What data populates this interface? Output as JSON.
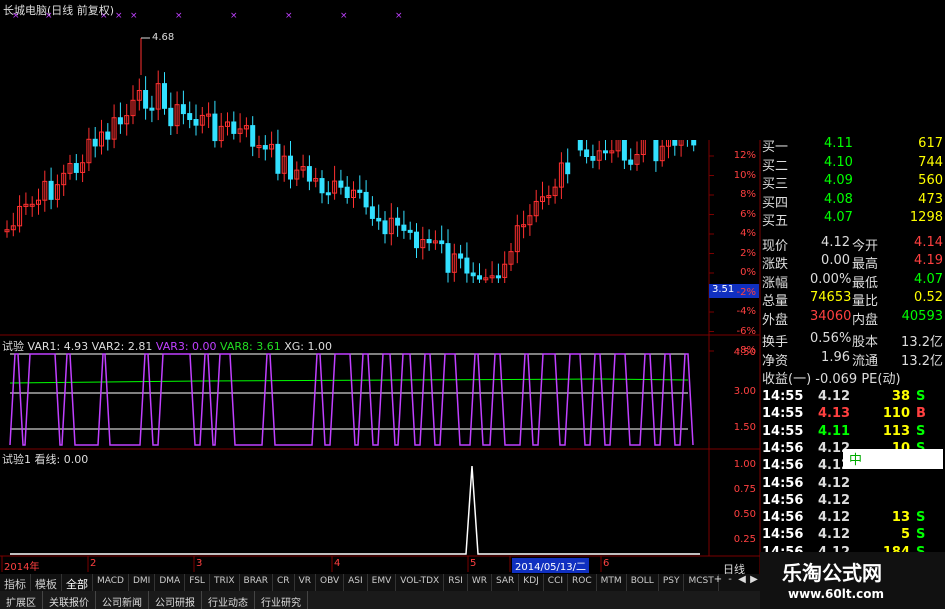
{
  "window_title": "长城电脑(日线 前复权)",
  "price_high_label": "4.68",
  "current_price_tag": "3.51",
  "colors": {
    "up": "#ff3030",
    "down": "#33e0ff",
    "magenta": "#c040ff",
    "green": "#00ff00",
    "yellow": "#ffff00",
    "grid": "#7a0000",
    "white": "#ffffff"
  },
  "pct_axis": [
    "12%",
    "10%",
    "8%",
    "6%",
    "4%",
    "2%",
    "0%",
    "-2%",
    "-4%",
    "-6%",
    "-8%"
  ],
  "indicator1": {
    "name": "试验",
    "vars": [
      {
        "label": "VAR1: 4.93",
        "color": "#dddddd"
      },
      {
        "label": "VAR2: 2.81",
        "color": "#dddddd"
      },
      {
        "label": "VAR3: 0.00",
        "color": "#c040ff"
      },
      {
        "label": "VAR8: 3.61",
        "color": "#22dd22"
      },
      {
        "label": "XG: 1.00",
        "color": "#dddddd"
      }
    ],
    "axis": [
      "4.50",
      "3.00",
      "1.50"
    ]
  },
  "indicator2": {
    "name": "试验1",
    "vars": [
      {
        "label": "看线: 0.00",
        "color": "#dddddd"
      }
    ],
    "axis": [
      "1.00",
      "0.75",
      "0.50",
      "0.25"
    ]
  },
  "date_axis": [
    {
      "label": "2014年",
      "highlight": false
    },
    {
      "label": "2",
      "highlight": false
    },
    {
      "label": "3",
      "highlight": false
    },
    {
      "label": "4",
      "highlight": false
    },
    {
      "label": "5",
      "highlight": false
    },
    {
      "label": "2014/05/13/二",
      "highlight": true
    },
    {
      "label": "6",
      "highlight": false
    }
  ],
  "period": "日线",
  "quotes": [
    {
      "label": "买一",
      "price": "4.11",
      "vol": "617",
      "pcolor": "#00ff00"
    },
    {
      "label": "买二",
      "price": "4.10",
      "vol": "744",
      "pcolor": "#00ff00"
    },
    {
      "label": "买三",
      "price": "4.09",
      "vol": "560",
      "pcolor": "#00ff00"
    },
    {
      "label": "买四",
      "price": "4.08",
      "vol": "473",
      "pcolor": "#00ff00"
    },
    {
      "label": "买五",
      "price": "4.07",
      "vol": "1298",
      "pcolor": "#00ff00"
    }
  ],
  "stats": [
    {
      "l1": "现价",
      "v1": "4.12",
      "c1": "#dddddd",
      "l2": "今开",
      "v2": "4.14",
      "c2": "#ff4040"
    },
    {
      "l1": "涨跌",
      "v1": "0.00",
      "c1": "#dddddd",
      "l2": "最高",
      "v2": "4.19",
      "c2": "#ff4040"
    },
    {
      "l1": "涨幅",
      "v1": "0.00%",
      "c1": "#dddddd",
      "l2": "最低",
      "v2": "4.07",
      "c2": "#00ff00"
    },
    {
      "l1": "总量",
      "v1": "74653",
      "c1": "#ffff00",
      "l2": "量比",
      "v2": "0.52",
      "c2": "#ffff00"
    },
    {
      "l1": "外盘",
      "v1": "34060",
      "c1": "#ff4040",
      "l2": "内盘",
      "v2": "40593",
      "c2": "#00ff00"
    },
    {
      "l1": "换手",
      "v1": "0.56%",
      "c1": "#dddddd",
      "l2": "股本",
      "v2": "13.2亿",
      "c2": "#dddddd"
    },
    {
      "l1": "净资",
      "v1": "1.96",
      "c1": "#dddddd",
      "l2": "流通",
      "v2": "13.2亿",
      "c2": "#dddddd"
    }
  ],
  "earnings": "收益(一) -0.069 PE(动)",
  "ticks": [
    {
      "time": "14:55",
      "price": "4.12",
      "vol": "38",
      "bs": "S",
      "pc": "#dddddd",
      "bc": "#00ff00"
    },
    {
      "time": "14:55",
      "price": "4.13",
      "vol": "110",
      "bs": "B",
      "pc": "#ff4040",
      "bc": "#ff4040"
    },
    {
      "time": "14:55",
      "price": "4.11",
      "vol": "113",
      "bs": "S",
      "pc": "#00ff00",
      "bc": "#00ff00"
    },
    {
      "time": "14:56",
      "price": "4.12",
      "vol": "10",
      "bs": "S",
      "pc": "#dddddd",
      "bc": "#00ff00"
    },
    {
      "time": "14:56",
      "price": "4.12",
      "vol": "2",
      "bs": "B",
      "pc": "#dddddd",
      "bc": "#ff4040"
    },
    {
      "time": "14:56",
      "price": "4.12",
      "vol": "",
      "bs": "",
      "pc": "#dddddd",
      "bc": "#dddddd"
    },
    {
      "time": "14:56",
      "price": "4.12",
      "vol": "",
      "bs": "",
      "pc": "#dddddd",
      "bc": "#dddddd"
    },
    {
      "time": "14:56",
      "price": "4.12",
      "vol": "13",
      "bs": "S",
      "pc": "#dddddd",
      "bc": "#00ff00"
    },
    {
      "time": "14:56",
      "price": "4.12",
      "vol": "5",
      "bs": "S",
      "pc": "#dddddd",
      "bc": "#00ff00"
    },
    {
      "time": "14:56",
      "price": "4.12",
      "vol": "184",
      "bs": "S",
      "pc": "#dddddd",
      "bc": "#00ff00"
    },
    {
      "time": "14:56",
      "price": "4.12",
      "vol": "58",
      "bs": "B",
      "pc": "#dddddd",
      "bc": "#ff4040"
    }
  ],
  "indicator_tabs": [
    "指标",
    "模板",
    "全部",
    "MACD",
    "DMI",
    "DMA",
    "FSL",
    "TRIX",
    "BRAR",
    "CR",
    "VR",
    "OBV",
    "ASI",
    "EMV",
    "VOL-TDX",
    "RSI",
    "WR",
    "SAR",
    "KDJ",
    "CCI",
    "ROC",
    "MTM",
    "BOLL",
    "PSY",
    "MCST"
  ],
  "bottom_tabs": [
    "扩展区",
    "关联报价",
    "公司新闻",
    "公司研报",
    "行业动态",
    "行业研究"
  ],
  "scroll_buttons": [
    "+",
    "-",
    "◀",
    "▶"
  ],
  "watermark": {
    "title": "乐淘公式网",
    "url": "www.60lt.com"
  },
  "badge_text": "中"
}
